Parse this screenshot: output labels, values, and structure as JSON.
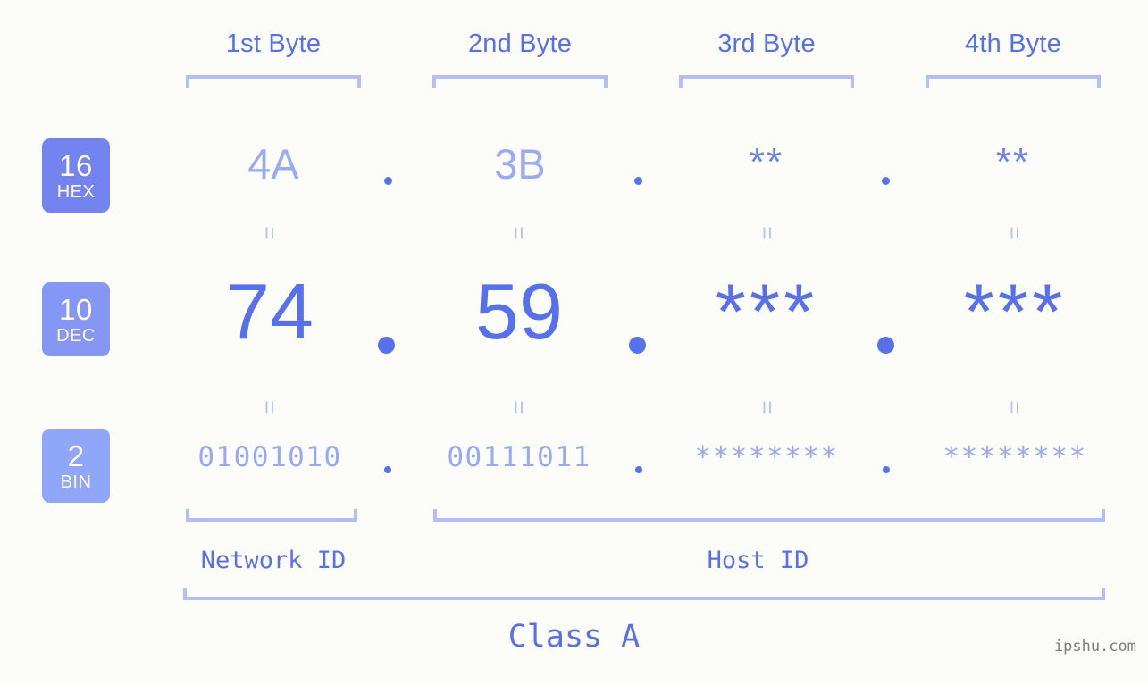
{
  "background_color": "#fcfdf8",
  "accent_color": "#5771ee",
  "light_accent_color": "#b4bdfb",
  "headers": [
    {
      "label": "1st Byte"
    },
    {
      "label": "2nd Byte"
    },
    {
      "label": "3rd Byte"
    },
    {
      "label": "4th Byte"
    }
  ],
  "rows": {
    "hex": {
      "badge_number": "16",
      "badge_name": "HEX",
      "badge_color": "#7383ef",
      "values": [
        "4A",
        "3B",
        "**",
        "**"
      ],
      "separator": "."
    },
    "dec": {
      "badge_number": "10",
      "badge_name": "DEC",
      "badge_color": "#8596f4",
      "values": [
        "74",
        "59",
        "***",
        "***"
      ],
      "separator": "."
    },
    "bin": {
      "badge_number": "2",
      "badge_name": "BIN",
      "badge_color": "#8fa6f9",
      "values": [
        "01001010",
        "00111011",
        "********",
        "********"
      ],
      "separator": "."
    }
  },
  "equals_mark": "=",
  "id_labels": {
    "network": "Network ID",
    "host": "Host ID"
  },
  "class_label": "Class A",
  "watermark": "ipshu.com"
}
